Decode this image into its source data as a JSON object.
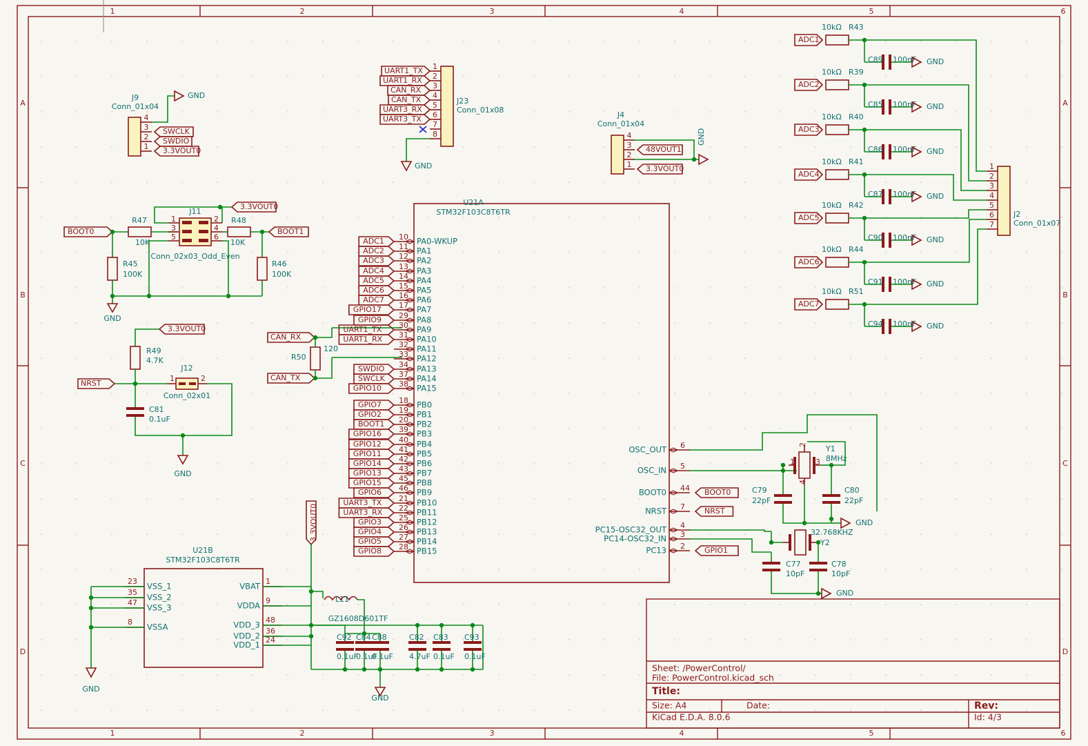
{
  "app": {
    "name": "KiCad Schematic Editor",
    "version": "KiCad E.D.A. 8.0.6"
  },
  "frame": {
    "columns": [
      "1",
      "2",
      "3",
      "4",
      "5",
      "6"
    ],
    "rows": [
      "A",
      "B",
      "C",
      "D"
    ]
  },
  "title_block": {
    "sheet": "Sheet: /PowerControl/",
    "file": "File: PowerControl.kicad_sch",
    "title_label": "Title:",
    "title_value": "",
    "size": "Size: A4",
    "date": "Date:",
    "rev": "Rev:",
    "eda": "KiCad E.D.A. 8.0.6",
    "id": "Id: 4/3"
  },
  "connectors": {
    "j9": {
      "ref": "J9",
      "value": "Conn_01x04",
      "pins": [
        "4",
        "3",
        "2",
        "1"
      ],
      "nets": [
        "GND",
        "SWCLK",
        "SWDIO",
        "3.3VOUT0"
      ]
    },
    "j23": {
      "ref": "J23",
      "value": "Conn_01x08",
      "pins": [
        "1",
        "2",
        "3",
        "4",
        "5",
        "6",
        "7",
        "8"
      ],
      "nets": [
        "UART1_TX",
        "UART1_RX",
        "CAN_RX",
        "CAN_TX",
        "UART3_RX",
        "UART3_TX",
        "",
        "GND"
      ]
    },
    "j4": {
      "ref": "J4",
      "value": "Conn_01x04",
      "pins": [
        "4",
        "3",
        "2",
        "1"
      ],
      "nets": [
        "GND",
        "48VOUT1",
        "GND",
        "3.3VOUT0"
      ]
    },
    "j11": {
      "ref": "J11",
      "value": "Conn_02x03_Odd_Even",
      "pins": [
        "1",
        "2",
        "3",
        "4",
        "5",
        "6"
      ]
    },
    "j12": {
      "ref": "J12",
      "value": "Conn_02x01",
      "pins": [
        "1",
        "2"
      ]
    },
    "j2": {
      "ref": "J2",
      "value": "Conn_01x07",
      "pins": [
        "1",
        "2",
        "3",
        "4",
        "5",
        "6",
        "7"
      ]
    }
  },
  "adc_filters": [
    {
      "net": "ADC1",
      "r_value": "10kΩ",
      "r_ref": "R43",
      "c_ref": "C89",
      "c_value": "100nF",
      "gnd": "GND"
    },
    {
      "net": "ADC2",
      "r_value": "10kΩ",
      "r_ref": "R39",
      "c_ref": "C85",
      "c_value": "100nF",
      "gnd": "GND"
    },
    {
      "net": "ADC3",
      "r_value": "10kΩ",
      "r_ref": "R40",
      "c_ref": "C86",
      "c_value": "100nF",
      "gnd": "GND"
    },
    {
      "net": "ADC4",
      "r_value": "10kΩ",
      "r_ref": "R41",
      "c_ref": "C87",
      "c_value": "100nF",
      "gnd": "GND"
    },
    {
      "net": "ADC5",
      "r_value": "10kΩ",
      "r_ref": "R42",
      "c_ref": "C90",
      "c_value": "100nF",
      "gnd": "GND"
    },
    {
      "net": "ADC6",
      "r_value": "10kΩ",
      "r_ref": "R44",
      "c_ref": "C91",
      "c_value": "100nF",
      "gnd": "GND"
    },
    {
      "net": "ADC7",
      "r_value": "10kΩ",
      "r_ref": "R51",
      "c_ref": "C94",
      "c_value": "100nF",
      "gnd": "GND"
    }
  ],
  "boot_network": {
    "net_boot0": "BOOT0",
    "net_boot1": "BOOT1",
    "net_vcc": "3.3VOUT0",
    "gnd": "GND",
    "r47": {
      "ref": "R47",
      "value": "10K"
    },
    "r48": {
      "ref": "R48",
      "value": "10K"
    },
    "r45": {
      "ref": "R45",
      "value": "100K"
    },
    "r46": {
      "ref": "R46",
      "value": "100K"
    }
  },
  "reset_network": {
    "net_nrst": "NRST",
    "net_vcc": "3.3VOUT0",
    "gnd": "GND",
    "r49": {
      "ref": "R49",
      "value": "4.7K"
    },
    "c81": {
      "ref": "C81",
      "value": "0.1uF"
    }
  },
  "can_term": {
    "ref": "R50",
    "value": "120",
    "net_rx": "CAN_RX",
    "net_tx": "CAN_TX"
  },
  "u21a": {
    "ref": "U21A",
    "value": "STM32F103C8T6TR",
    "port_a": [
      {
        "pin": "10",
        "name": "PA0-WKUP",
        "net": "ADC1"
      },
      {
        "pin": "11",
        "name": "PA1",
        "net": "ADC2"
      },
      {
        "pin": "12",
        "name": "PA2",
        "net": "ADC3"
      },
      {
        "pin": "13",
        "name": "PA3",
        "net": "ADC4"
      },
      {
        "pin": "14",
        "name": "PA4",
        "net": "ADC5"
      },
      {
        "pin": "15",
        "name": "PA5",
        "net": "ADC6"
      },
      {
        "pin": "16",
        "name": "PA6",
        "net": "ADC7"
      },
      {
        "pin": "17",
        "name": "PA7",
        "net": "GPIO17"
      },
      {
        "pin": "29",
        "name": "PA8",
        "net": "GPIO9"
      },
      {
        "pin": "30",
        "name": "PA9",
        "net": "UART1_TX"
      },
      {
        "pin": "31",
        "name": "PA10",
        "net": "UART1_RX"
      },
      {
        "pin": "32",
        "name": "PA11",
        "net": ""
      },
      {
        "pin": "33",
        "name": "PA12",
        "net": ""
      },
      {
        "pin": "34",
        "name": "PA13",
        "net": "SWDIO"
      },
      {
        "pin": "37",
        "name": "PA14",
        "net": "SWCLK"
      },
      {
        "pin": "38",
        "name": "PA15",
        "net": "GPIO10"
      }
    ],
    "port_b": [
      {
        "pin": "18",
        "name": "PB0",
        "net": "GPIO7"
      },
      {
        "pin": "19",
        "name": "PB1",
        "net": "GPIO2"
      },
      {
        "pin": "20",
        "name": "PB2",
        "net": "BOOT1"
      },
      {
        "pin": "39",
        "name": "PB3",
        "net": "GPIO16"
      },
      {
        "pin": "40",
        "name": "PB4",
        "net": "GPIO12"
      },
      {
        "pin": "41",
        "name": "PB5",
        "net": "GPIO11"
      },
      {
        "pin": "42",
        "name": "PB6",
        "net": "GPIO14"
      },
      {
        "pin": "43",
        "name": "PB7",
        "net": "GPIO13"
      },
      {
        "pin": "45",
        "name": "PB8",
        "net": "GPIO15"
      },
      {
        "pin": "46",
        "name": "PB9",
        "net": "GPIO6"
      },
      {
        "pin": "21",
        "name": "PB10",
        "net": "UART3_TX"
      },
      {
        "pin": "22",
        "name": "PB11",
        "net": "UART3_RX"
      },
      {
        "pin": "25",
        "name": "PB12",
        "net": "GPIO3"
      },
      {
        "pin": "26",
        "name": "PB13",
        "net": "GPIO4"
      },
      {
        "pin": "27",
        "name": "PB14",
        "net": "GPIO5"
      },
      {
        "pin": "28",
        "name": "PB15",
        "net": "GPIO8"
      }
    ],
    "right_pins": [
      {
        "pin": "6",
        "name": "OSC_OUT",
        "net": ""
      },
      {
        "pin": "5",
        "name": "OSC_IN",
        "net": ""
      },
      {
        "pin": "44",
        "name": "BOOT0",
        "net": "BOOT0"
      },
      {
        "pin": "7",
        "name": "NRST",
        "net": "NRST"
      },
      {
        "pin": "4",
        "name": "PC15-OSC32_OUT",
        "net": ""
      },
      {
        "pin": "3",
        "name": "PC14-OSC32_IN",
        "net": ""
      },
      {
        "pin": "2",
        "name": "PC13",
        "net": "GPIO1"
      }
    ]
  },
  "u21b": {
    "ref": "U21B",
    "value": "STM32F103C8T6TR",
    "left_pins": [
      {
        "pin": "23",
        "name": "VSS_1"
      },
      {
        "pin": "35",
        "name": "VSS_2"
      },
      {
        "pin": "47",
        "name": "VSS_3"
      },
      {
        "pin": "8",
        "name": "VSSA"
      }
    ],
    "right_pins": [
      {
        "pin": "1",
        "name": "VBAT"
      },
      {
        "pin": "9",
        "name": "VDDA"
      },
      {
        "pin": "48",
        "name": "VDD_3"
      },
      {
        "pin": "36",
        "name": "VDD_2"
      },
      {
        "pin": "24",
        "name": "VDD_1"
      }
    ],
    "gnd": "GND"
  },
  "power_decoupling": {
    "net_vcc": "3.3VOUT0",
    "ferrite": {
      "ref": "L11",
      "value": "GZ1608D601TF"
    },
    "caps": [
      {
        "ref": "C92",
        "value": "0.1uF"
      },
      {
        "ref": "C84",
        "value": "0.1uF"
      },
      {
        "ref": "C88",
        "value": "0.1uF"
      },
      {
        "ref": "C82",
        "value": "4.7uF"
      },
      {
        "ref": "C83",
        "value": "0.1uF"
      },
      {
        "ref": "C93",
        "value": "0.1uF"
      }
    ],
    "gnd": "GND"
  },
  "crystals": {
    "y1": {
      "ref": "Y1",
      "value": "8MHz",
      "c_left": {
        "ref": "C79",
        "value": "22pF"
      },
      "c_right": {
        "ref": "C80",
        "value": "22pF"
      },
      "gnd": "GND"
    },
    "y2": {
      "ref": "Y2",
      "value": "32.768KHZ",
      "c_left": {
        "ref": "C77",
        "value": "10pF"
      },
      "c_right": {
        "ref": "C78",
        "value": "10pF"
      },
      "gnd": "GND"
    }
  },
  "colors": {
    "background": "#f7f6f1",
    "symbol": "#8b1a1a",
    "wire": "#0a8a18",
    "value_text": "#107070",
    "pin_fill": "#fbf3bf"
  }
}
